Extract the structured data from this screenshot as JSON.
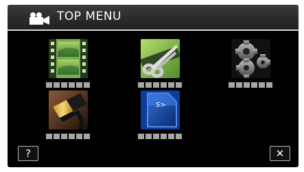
{
  "header": {
    "title": "TOP MENU",
    "icon": "video-camera-icon"
  },
  "menu_items": [
    {
      "name": "video-playback",
      "icon": "film-icon",
      "label": "••••••"
    },
    {
      "name": "edit",
      "icon": "scissors-icon",
      "label": "••••••"
    },
    {
      "name": "settings",
      "icon": "gears-icon",
      "label": "••••••"
    },
    {
      "name": "hdmi-connection",
      "icon": "hdmi-cable-icon",
      "label": "••••••"
    },
    {
      "name": "sd-card",
      "icon": "sd-card-icon",
      "label": "••••••"
    }
  ],
  "footer": {
    "help_label": "?",
    "close_label": "✕"
  },
  "colors": {
    "background": "#000000",
    "header": "#2b2b2b",
    "label_dots": "#a6a6a6"
  }
}
